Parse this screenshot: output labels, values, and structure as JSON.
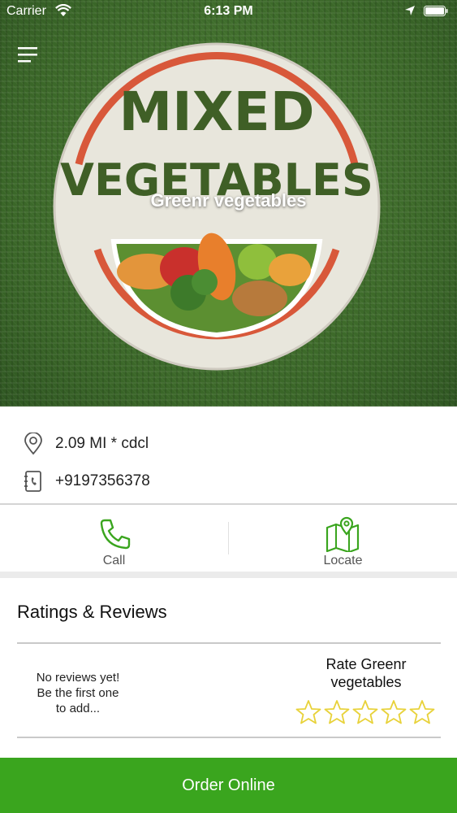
{
  "status_bar": {
    "carrier": "Carrier",
    "time": "6:13 PM"
  },
  "hero": {
    "logo_line1": "MIXED",
    "logo_line2": "VEGETABLES",
    "title": "Greenr vegetables"
  },
  "info": {
    "distance": "2.09 MI * cdcl",
    "phone": "+9197356378"
  },
  "actions": {
    "call_label": "Call",
    "locate_label": "Locate"
  },
  "reviews": {
    "title": "Ratings & Reviews",
    "empty_line1": "No reviews yet!",
    "empty_line2": "Be the first one",
    "empty_line3": "to add...",
    "rate_line1": "Rate Greenr",
    "rate_line2": "vegetables",
    "stars_filled": 0,
    "stars_total": 5
  },
  "order": {
    "label": "Order Online"
  },
  "colors": {
    "accent_green": "#3aa51e",
    "icon_green": "#3aa51e",
    "star_yellow": "#e8d23a"
  },
  "icons": {
    "menu": "hamburger-icon",
    "location": "location-pin-icon",
    "phone_book": "phone-book-icon",
    "call": "phone-icon",
    "locate": "map-pin-icon",
    "star": "star-outline-icon"
  }
}
